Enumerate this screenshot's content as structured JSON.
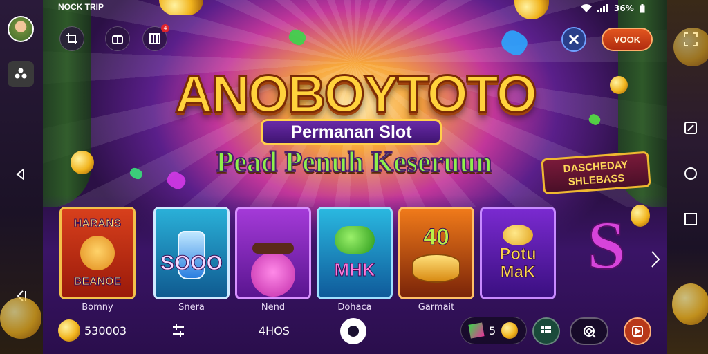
{
  "status_bar": {
    "carrier": "NOCK TRIP",
    "battery": "36%"
  },
  "left_rail": {
    "avatar": "avatar",
    "icons": [
      "game-controller-icon",
      "back-triangle-icon",
      "back-arrow-icon"
    ]
  },
  "right_rail": {
    "icons": [
      "fullscreen-icon",
      "screenshot-icon",
      "home-circle-icon",
      "recents-square-icon"
    ]
  },
  "top_bar": {
    "icons": [
      "crop-icon",
      "gift-icon",
      "grid-panel-icon"
    ],
    "notification_badge": "4",
    "close_icon": "close-icon",
    "vook_button": "VOOK"
  },
  "hero": {
    "logo": "ANOBOYTOTO",
    "subtitle": "Permanan Slot",
    "tagline": "Pead Penuh Keseruun",
    "promo_line1": "DASCHEDAY",
    "promo_line2": "SHLEBASS"
  },
  "games": [
    {
      "art_top": "HARANS",
      "art_bottom": "BEANOE",
      "label": "Bomny",
      "colors": {
        "bg": "#c4301a",
        "border": "#f3c14a"
      }
    },
    {
      "art_top": "",
      "art_bottom": "SOOO",
      "label": "Snera",
      "colors": {
        "bg": "#1d8fb8",
        "border": "#cfe9ff"
      }
    },
    {
      "art_top": "",
      "art_bottom": "",
      "label": "Nend",
      "colors": {
        "bg": "#8a2ab8",
        "border": "#d890ff"
      }
    },
    {
      "art_top": "",
      "art_bottom": "MHK",
      "label": "Dohaca",
      "colors": {
        "bg": "#1f9ac8",
        "border": "#9fe0ff"
      }
    },
    {
      "art_top": "40",
      "art_bottom": "",
      "label": "Garmait",
      "colors": {
        "bg": "#d45c12",
        "border": "#ffc067"
      }
    },
    {
      "art_top": "Potu",
      "art_bottom": "MaK",
      "label": "",
      "colors": {
        "bg": "#5a22a8",
        "border": "#c88aff"
      }
    }
  ],
  "bottom_bar": {
    "balance": "530003",
    "wins": "4HOS",
    "badge_count": "5",
    "icons": [
      "balance-coins-icon",
      "settings-sliders-icon",
      "record-icon",
      "grid-icon",
      "search-icon",
      "play-icon"
    ]
  }
}
